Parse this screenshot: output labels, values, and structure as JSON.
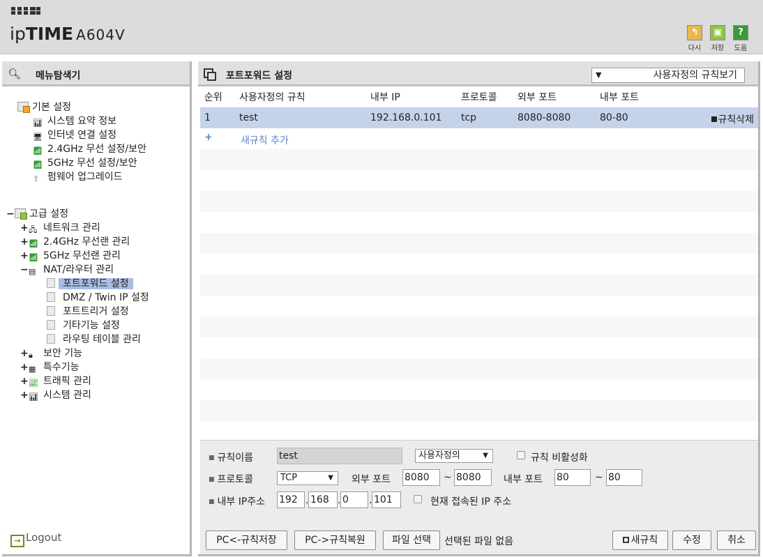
{
  "header": {
    "brand_pre": "ip",
    "brand_tm": "TIME",
    "model": "A604V",
    "buttons": [
      {
        "label": "다시",
        "color": "#e8b84a",
        "icon": "refresh-icon"
      },
      {
        "label": "저장",
        "color": "#8cc63f",
        "icon": "save-icon"
      },
      {
        "label": "도움",
        "color": "#3a9a3a",
        "icon": "help-icon"
      }
    ]
  },
  "sidebar": {
    "title": "메뉴탐색기",
    "basic": {
      "label": "기본 설정",
      "items": [
        "시스템 요약 정보",
        "인터넷 연결 설정",
        "2.4GHz 무선 설정/보안",
        "5GHz 무선 설정/보안",
        "펌웨어 업그레이드"
      ]
    },
    "advanced": {
      "toggle": "−",
      "label": "고급 설정",
      "groups": [
        {
          "toggle": "+",
          "label": "네트워크 관리"
        },
        {
          "toggle": "+",
          "label": "2.4GHz 무선랜 관리"
        },
        {
          "toggle": "+",
          "label": "5GHz 무선랜 관리"
        },
        {
          "toggle": "−",
          "label": "NAT/라우터 관리"
        },
        {
          "toggle": "+",
          "label": "보안 기능"
        },
        {
          "toggle": "+",
          "label": "특수기능"
        },
        {
          "toggle": "+",
          "label": "트래픽 관리"
        },
        {
          "toggle": "+",
          "label": "시스템 관리"
        }
      ],
      "nat_items": [
        "포트포워드 설정",
        "DMZ / Twin IP 설정",
        "포트트리거 설정",
        "기타기능 설정",
        "라우팅 테이블 관리"
      ]
    },
    "logout": "Logout"
  },
  "main": {
    "title": "포트포워드 설정",
    "view_select": "사용자정의 규칙보기",
    "columns": [
      "순위",
      "사용자정의 규칙",
      "내부 IP",
      "프로토콜",
      "외부 포트",
      "내부 포트"
    ],
    "rules": [
      {
        "rank": "1",
        "name": "test",
        "internal_ip": "192.168.0.101",
        "protocol": "tcp",
        "external_port": "8080-8080",
        "internal_port": "80-80",
        "delete_label": "규칙삭제"
      }
    ],
    "add_plus": "+",
    "add_label": "새규칙 추가"
  },
  "form": {
    "rule_name_label": "규칙이름",
    "rule_name_value": "test",
    "rule_type": "사용자정의",
    "disable_label": "규칙 비활성화",
    "protocol_label": "프로토콜",
    "protocol_value": "TCP",
    "ext_port_label": "외부 포트",
    "ext_port_from": "8080",
    "ext_port_to": "8080",
    "int_port_label": "내부 포트",
    "int_port_from": "80",
    "int_port_to": "80",
    "tilde": "~",
    "ip_label": "내부 IP주소",
    "ip": [
      "192",
      "168",
      "0",
      "101"
    ],
    "current_ip_label": "현재 접속된 IP 주소",
    "buttons": {
      "backup": "PC<-규칙저장",
      "restore": "PC->규칙복원",
      "file_select": "파일 선택",
      "no_file": "선택된 파일 없음",
      "new_rule": "새규칙",
      "modify": "수정",
      "cancel": "취소"
    }
  }
}
